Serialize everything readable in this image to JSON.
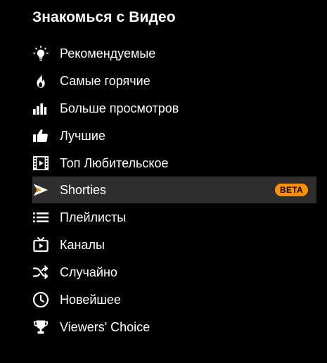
{
  "menu": {
    "heading": "Знакомься с Видео",
    "items": [
      {
        "label": "Рекомендуемые",
        "icon": "lightbulb-icon"
      },
      {
        "label": "Самые горячие",
        "icon": "flame-icon"
      },
      {
        "label": "Больше просмотров",
        "icon": "bar-chart-icon"
      },
      {
        "label": "Лучшие",
        "icon": "thumbs-up-icon"
      },
      {
        "label": "Топ Любительское",
        "icon": "film-strip-icon"
      },
      {
        "label": "Shorties",
        "icon": "shorties-arrow-icon",
        "active": true,
        "badge": "BETA"
      },
      {
        "label": "Плейлисты",
        "icon": "list-icon"
      },
      {
        "label": "Каналы",
        "icon": "channel-tv-icon"
      },
      {
        "label": "Случайно",
        "icon": "shuffle-icon"
      },
      {
        "label": "Новейшее",
        "icon": "clock-icon"
      },
      {
        "label": "Viewers' Choice",
        "icon": "trophy-icon"
      }
    ]
  },
  "colors": {
    "background": "#000000",
    "text": "#ffffff",
    "active_row": "#2e2e2e",
    "accent": "#ff9000"
  }
}
